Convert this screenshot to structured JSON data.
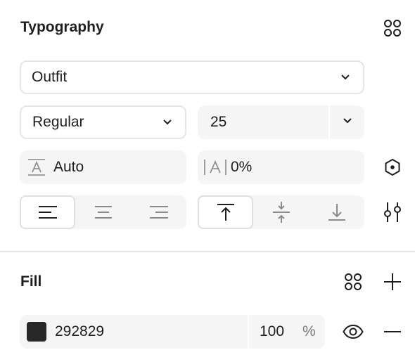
{
  "typography": {
    "title": "Typography",
    "font_family": "Outfit",
    "font_weight": "Regular",
    "font_size": "25",
    "line_height": "Auto",
    "letter_spacing": "0%",
    "text_align_options": [
      "align-left",
      "align-center",
      "align-right"
    ],
    "text_align_selected": "align-left",
    "vertical_align_options": [
      "align-top",
      "align-middle",
      "align-bottom"
    ],
    "vertical_align_selected": "align-top"
  },
  "fill": {
    "title": "Fill",
    "color_hex": "292829",
    "swatch_color": "#292829",
    "opacity": "100",
    "opacity_unit": "%"
  },
  "icons": {
    "styles": "styles-grid-icon",
    "variables": "hexagon-variable-icon",
    "settings": "sliders-icon",
    "add": "plus-icon",
    "visibility": "eye-icon",
    "remove": "minus-icon",
    "dropdown": "chevron-down-icon"
  }
}
